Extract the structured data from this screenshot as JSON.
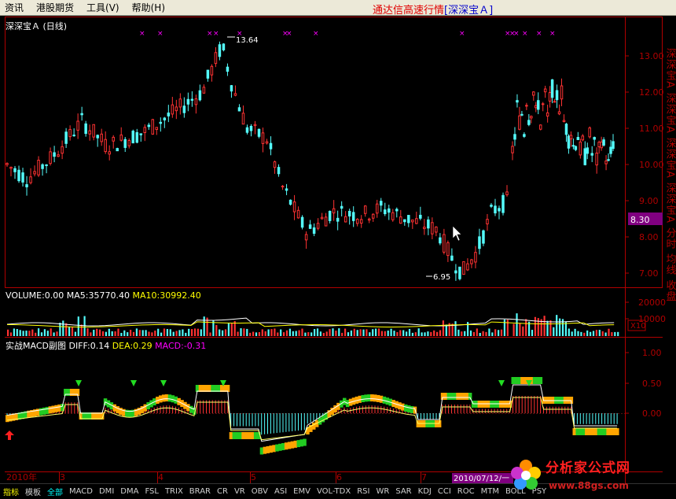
{
  "menu": {
    "items": [
      "资讯",
      "港股期货",
      "工具(V)",
      "帮助(H)"
    ],
    "app_title": "通达信高速行情",
    "symbol_title": "[深深宝Ａ]"
  },
  "main_pane": {
    "title": "深深宝Ａ",
    "period": "(日线)",
    "price_ticks": [
      "13.00",
      "12.00",
      "11.00",
      "10.00",
      "9.00",
      "8.00",
      "7.00"
    ],
    "high_label": "13.64",
    "low_label": "6.95",
    "last_price": "8.30",
    "side_strip_text": "深深宝A 深深宝A 深深宝A 深深宝A 分时 均线 收盘"
  },
  "volume_pane": {
    "label": "VOLUME:0.00",
    "ma5": "MA5:35770.40",
    "ma10": "MA10:30992.40",
    "ticks": [
      "20000",
      "10000"
    ],
    "unit": "X10"
  },
  "macd_pane": {
    "name": "实战MACD副图",
    "diff": "DIFF:0.14",
    "dea": "DEA:0.29",
    "macd": "MACD:-0.31",
    "ticks": [
      "1.00",
      "0.50",
      "0.00"
    ]
  },
  "time_axis": {
    "year": "2010年",
    "months": [
      "3",
      "4",
      "5",
      "6",
      "7"
    ],
    "cursor_date": "2010/07/12/一"
  },
  "tabs": [
    "指标",
    "模板",
    "全部",
    "MACD",
    "DMI",
    "DMA",
    "FSL",
    "TRIX",
    "BRAR",
    "CR",
    "VR",
    "OBV",
    "ASI",
    "EMV",
    "VOL-TDX",
    "RSI",
    "WR",
    "SAR",
    "KDJ",
    "CCI",
    "ROC",
    "MTM",
    "BOLL",
    "PSY"
  ],
  "active_tab": "全部",
  "watermark": {
    "brand": "分析家公式网",
    "url": "www.88gs.com"
  },
  "colors": {
    "up": "#ff3232",
    "down": "#54fcfc",
    "axis": "#b00000",
    "yellow": "#ffff00",
    "magenta": "#ff00ff",
    "accent_label": "#800080"
  }
}
